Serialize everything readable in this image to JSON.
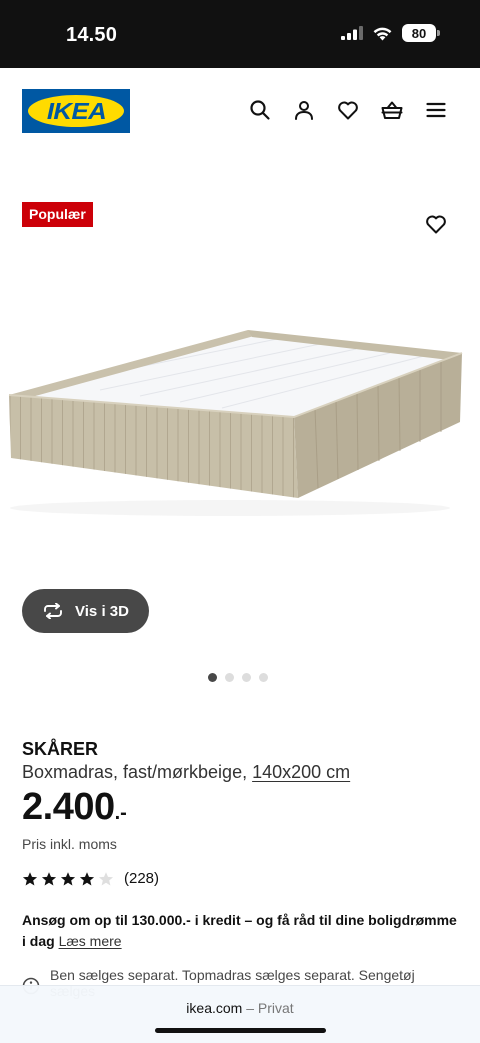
{
  "status_bar": {
    "time": "14.50",
    "battery": "80"
  },
  "header": {
    "logo_text": "IKEA",
    "icons": [
      "search-icon",
      "account-icon",
      "favorites-icon",
      "cart-icon",
      "menu-icon"
    ]
  },
  "product": {
    "badge": "Populær",
    "view_3d_label": "Vis i 3D",
    "gallery": {
      "images": 4,
      "active": 1
    },
    "name": "SKÅRER",
    "description": "Boxmadras, fast/mørkbeige,",
    "size": "140x200 cm",
    "price": "2.400",
    "price_suffix": ".-",
    "vat_note": "Pris inkl. moms",
    "rating": {
      "stars": 4,
      "max": 5,
      "count": "(228)"
    },
    "credit_text": "Ansøg om op til 130.000.- i kredit – og få råd til dine boligdrømme i dag",
    "credit_link": "Læs mere",
    "info_text": "Ben sælges separat. Topmadras sælges separat. Sengetøj sælges"
  },
  "browser": {
    "domain": "ikea.com",
    "mode": "– Privat"
  },
  "colors": {
    "ikea_blue": "#0058a3",
    "ikea_yellow": "#ffdb00",
    "badge_red": "#cc0008",
    "button_dark": "#484848"
  }
}
